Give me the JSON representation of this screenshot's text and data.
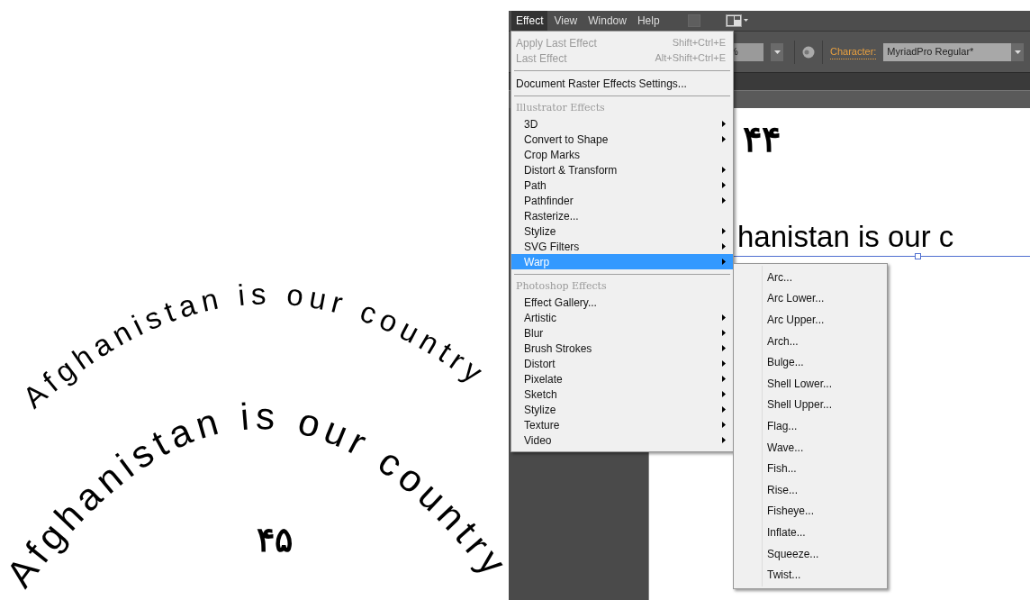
{
  "artwork": {
    "arc_text": "Afghanistan is our country",
    "arch_text": "Afghanistan is our country",
    "page_number": "۴۵"
  },
  "menubar": [
    {
      "label": "Effect",
      "selected": true
    },
    {
      "label": "View",
      "selected": false
    },
    {
      "label": "Window",
      "selected": false
    },
    {
      "label": "Help",
      "selected": false
    }
  ],
  "toolbar": {
    "zoom_value": "%",
    "character_label": "Character:",
    "font_value": "MyriadPro Regular*"
  },
  "canvas": {
    "page_number": "۴۴",
    "selected_text": "hanistan is our c"
  },
  "effect_menu": [
    {
      "kind": "item",
      "label": "Apply Last Effect",
      "shortcut": "Shift+Ctrl+E",
      "disabled": true,
      "submenu": false,
      "selected": false
    },
    {
      "kind": "item",
      "label": "Last Effect",
      "shortcut": "Alt+Shift+Ctrl+E",
      "disabled": true,
      "submenu": false,
      "selected": false
    },
    {
      "kind": "separator"
    },
    {
      "kind": "item",
      "label": "Document Raster Effects Settings...",
      "disabled": false,
      "submenu": false,
      "selected": false
    },
    {
      "kind": "separator"
    },
    {
      "kind": "label",
      "label": "Illustrator Effects"
    },
    {
      "kind": "item",
      "label": "3D",
      "disabled": false,
      "submenu": true,
      "selected": false
    },
    {
      "kind": "item",
      "label": "Convert to Shape",
      "disabled": false,
      "submenu": true,
      "selected": false
    },
    {
      "kind": "item",
      "label": "Crop Marks",
      "disabled": false,
      "submenu": false,
      "selected": false
    },
    {
      "kind": "item",
      "label": "Distort & Transform",
      "disabled": false,
      "submenu": true,
      "selected": false
    },
    {
      "kind": "item",
      "label": "Path",
      "disabled": false,
      "submenu": true,
      "selected": false
    },
    {
      "kind": "item",
      "label": "Pathfinder",
      "disabled": false,
      "submenu": true,
      "selected": false
    },
    {
      "kind": "item",
      "label": "Rasterize...",
      "disabled": false,
      "submenu": false,
      "selected": false
    },
    {
      "kind": "item",
      "label": "Stylize",
      "disabled": false,
      "submenu": true,
      "selected": false
    },
    {
      "kind": "item",
      "label": "SVG Filters",
      "disabled": false,
      "submenu": true,
      "selected": false
    },
    {
      "kind": "item",
      "label": "Warp",
      "disabled": false,
      "submenu": true,
      "selected": true
    },
    {
      "kind": "separator"
    },
    {
      "kind": "label",
      "label": "Photoshop Effects"
    },
    {
      "kind": "item",
      "label": "Effect Gallery...",
      "disabled": false,
      "submenu": false,
      "selected": false
    },
    {
      "kind": "item",
      "label": "Artistic",
      "disabled": false,
      "submenu": true,
      "selected": false
    },
    {
      "kind": "item",
      "label": "Blur",
      "disabled": false,
      "submenu": true,
      "selected": false
    },
    {
      "kind": "item",
      "label": "Brush Strokes",
      "disabled": false,
      "submenu": true,
      "selected": false
    },
    {
      "kind": "item",
      "label": "Distort",
      "disabled": false,
      "submenu": true,
      "selected": false
    },
    {
      "kind": "item",
      "label": "Pixelate",
      "disabled": false,
      "submenu": true,
      "selected": false
    },
    {
      "kind": "item",
      "label": "Sketch",
      "disabled": false,
      "submenu": true,
      "selected": false
    },
    {
      "kind": "item",
      "label": "Stylize",
      "disabled": false,
      "submenu": true,
      "selected": false
    },
    {
      "kind": "item",
      "label": "Texture",
      "disabled": false,
      "submenu": true,
      "selected": false
    },
    {
      "kind": "item",
      "label": "Video",
      "disabled": false,
      "submenu": true,
      "selected": false
    }
  ],
  "warp_submenu": [
    "Arc...",
    "Arc Lower...",
    "Arc Upper...",
    "Arch...",
    "Bulge...",
    "Shell Lower...",
    "Shell Upper...",
    "Flag...",
    "Wave...",
    "Fish...",
    "Rise...",
    "Fisheye...",
    "Inflate...",
    "Squeeze...",
    "Twist..."
  ]
}
